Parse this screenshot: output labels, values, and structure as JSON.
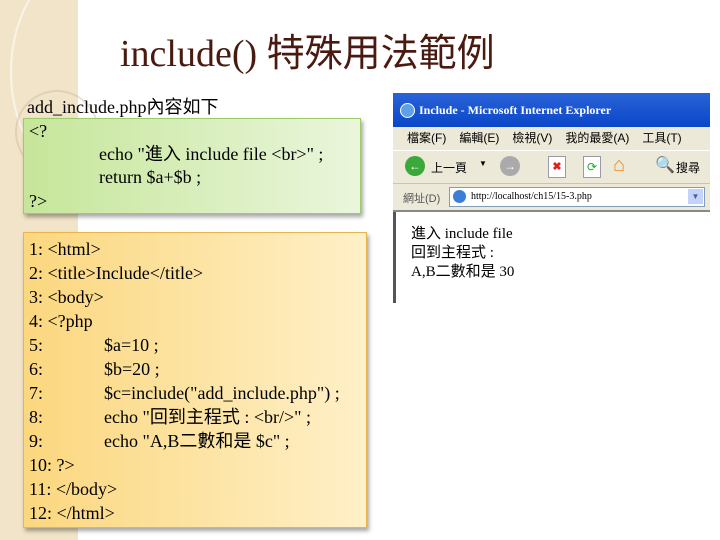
{
  "title": "include() 特殊用法範例",
  "label": "add_include.php內容如下",
  "include_code": {
    "l1": "<?",
    "l2": "echo \"進入 include file <br>\" ;",
    "l3": "return $a+$b ;",
    "l4": "?>"
  },
  "main_code": [
    {
      "n": "1: ",
      "t": "<html>",
      "ind": false
    },
    {
      "n": "2: ",
      "t": "<title>Include</title>",
      "ind": false
    },
    {
      "n": "3: ",
      "t": "<body>",
      "ind": false
    },
    {
      "n": "4: ",
      "t": "<?php",
      "ind": false
    },
    {
      "n": "5: ",
      "t": "$a=10 ;",
      "ind": true
    },
    {
      "n": "6: ",
      "t": "$b=20 ;",
      "ind": true
    },
    {
      "n": "7: ",
      "t": "$c=include(\"add_include.php\") ;",
      "ind": true
    },
    {
      "n": "8: ",
      "t": "echo \"回到主程式 : <br/>\" ;",
      "ind": true
    },
    {
      "n": "9: ",
      "t": "echo \"A,B二數和是 $c\" ;",
      "ind": true
    },
    {
      "n": "10: ",
      "t": "?>",
      "ind": false
    },
    {
      "n": "11: ",
      "t": "</body>",
      "ind": false
    },
    {
      "n": "12: ",
      "t": "</html>",
      "ind": false
    }
  ],
  "browser": {
    "window_title": "Include - Microsoft Internet Explorer",
    "menu": [
      "檔案(F)",
      "編輯(E)",
      "檢視(V)",
      "我的最愛(A)",
      "工具(T)"
    ],
    "back": "上一頁",
    "search": "搜尋",
    "address_label": "網址(D)",
    "url": "http://localhost/ch15/15-3.php",
    "output": [
      "進入 include file",
      "回到主程式 :",
      "A,B二數和是 30"
    ]
  }
}
